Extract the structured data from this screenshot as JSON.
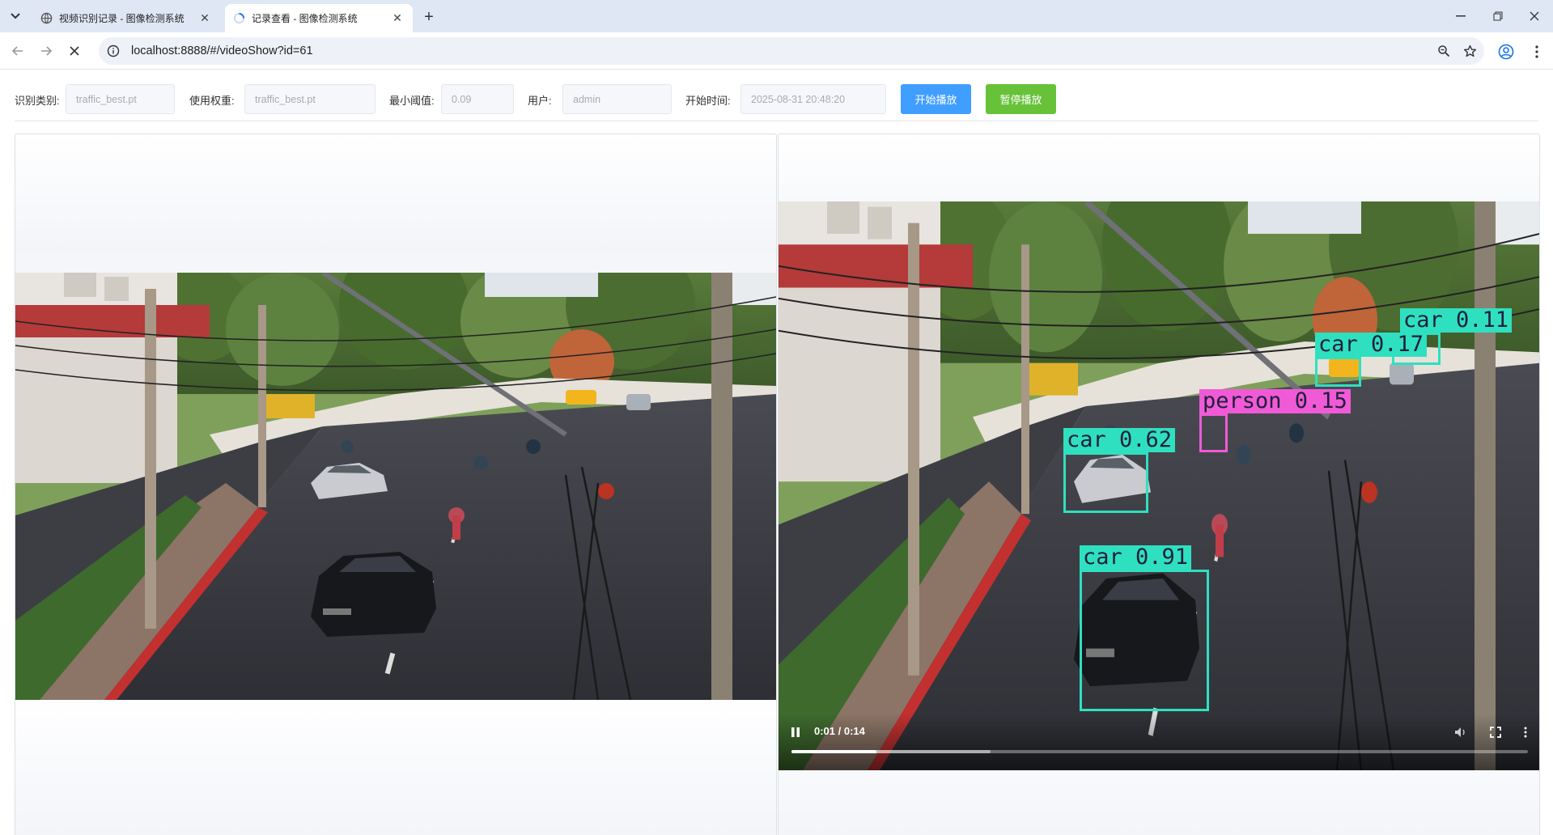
{
  "browser": {
    "tabs": [
      {
        "title": "视频识别记录 - 图像检测系统",
        "active": false
      },
      {
        "title": "记录查看 - 图像检测系统",
        "active": true
      }
    ],
    "url": "localhost:8888/#/videoShow?id=61"
  },
  "form": {
    "category_label": "识别类别:",
    "category_value": "traffic_best.pt",
    "weight_label": "使用权重:",
    "weight_value": "traffic_best.pt",
    "threshold_label": "最小阈值:",
    "threshold_value": "0.09",
    "user_label": "用户:",
    "user_value": "admin",
    "start_time_label": "开始时间:",
    "start_time_value": "2025-08-31 20:48:20",
    "play_button": "开始播放",
    "pause_button": "暂停播放"
  },
  "detections": [
    {
      "label": "car 0.91",
      "color": "#2fe0c0"
    },
    {
      "label": "car 0.62",
      "color": "#2fe0c0"
    },
    {
      "label": "person 0.15",
      "color": "#f05ad7"
    },
    {
      "label": "car 0.17",
      "color": "#2fe0c0"
    },
    {
      "label": "car 0.11",
      "color": "#2fe0c0"
    }
  ],
  "player": {
    "time": "0:01 / 0:14",
    "played_fraction": 0.115,
    "buffered_fraction": 0.27
  },
  "colors": {
    "primary": "#409eff",
    "success": "#67c23a",
    "box_cyan": "#2fe0c0",
    "box_pink": "#f05ad7"
  }
}
